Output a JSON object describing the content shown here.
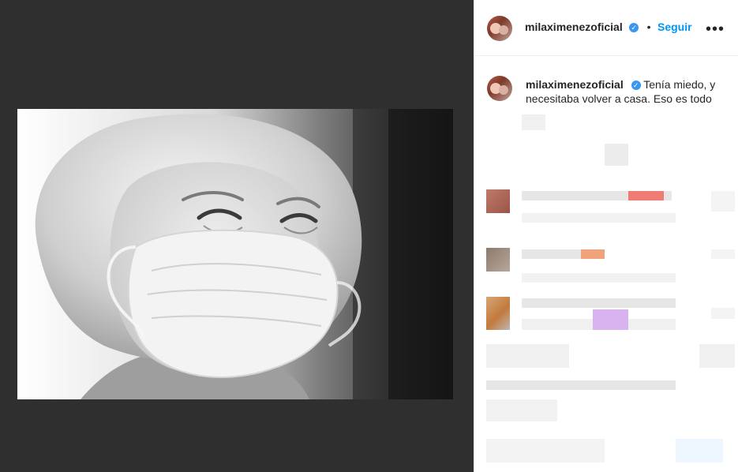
{
  "post": {
    "username": "milaximenezoficial",
    "follow_label": "Seguir",
    "separator": "•",
    "more": "•••",
    "caption_text": "Tenía miedo, y necesitaba volver a casa. Eso es todo",
    "verified_glyph": "✓"
  },
  "icons": {
    "verified": "verified-badge-icon",
    "more": "more-options-icon"
  },
  "colors": {
    "accent": "#0095f6",
    "verified": "#3897f0",
    "text": "#262626",
    "media_bg": "#2f2f2f"
  }
}
